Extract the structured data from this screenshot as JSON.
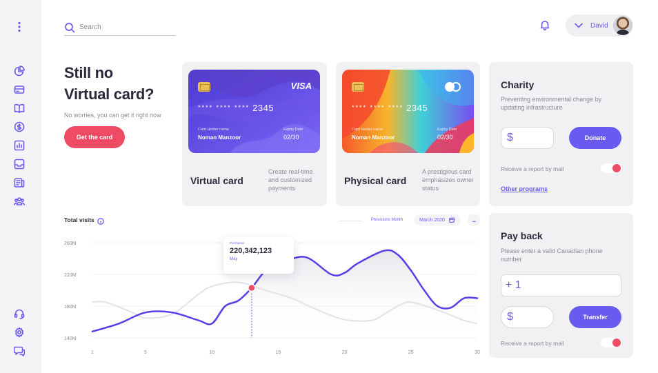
{
  "header": {
    "search_placeholder": "Search",
    "user_name": "David"
  },
  "sidebar": {
    "items": [
      "menu-dots",
      "pie-chart",
      "credit-card",
      "book",
      "dollar",
      "bar-chart",
      "inbox",
      "news",
      "people"
    ],
    "bottom_items": [
      "headset",
      "settings",
      "chat"
    ]
  },
  "hero": {
    "title_line1": "Still no",
    "title_line2": "Virtual card?",
    "subtitle": "No worries, you can get it right now",
    "button_label": "Get the card"
  },
  "virtual_card": {
    "brand": "VISA",
    "number_masked": "**** **** ****",
    "number_last": "2345",
    "holder_label": "Card Holder name",
    "holder_name": "Noman Manzoor",
    "expiry_label": "Expiry Date",
    "expiry": "02/30",
    "title": "Virtual card",
    "description": "Create real-time and customized payments"
  },
  "physical_card": {
    "number_masked": "**** **** ****",
    "number_last": "2345",
    "holder_label": "Card Holder name",
    "holder_name": "Noman Manzoor",
    "expiry_label": "Expiry Date",
    "expiry": "02/30",
    "title": "Physical card",
    "description": "A prestigious card emphasizes owner status"
  },
  "charity": {
    "title": "Charity",
    "description": "Preventing environmental change by updating infrastructure",
    "currency_symbol": "$",
    "donate_label": "Donate",
    "report_label": "Receive a report by mail",
    "report_toggle_on": true,
    "link_label": "Other programs"
  },
  "payback": {
    "title": "Pay back",
    "description": "Please enter a valid Canadian phone number",
    "phone_prefix": "+ 1",
    "currency_symbol": "$",
    "transfer_label": "Transfer",
    "report_label": "Receive a report by mail",
    "report_toggle_on": true
  },
  "chart_controls": {
    "title": "Total visits",
    "legend_label": "Provisions Month",
    "month_label": "March 2020",
    "more_label": "..."
  },
  "tooltip": {
    "label": "Purchases",
    "value": "220,342,123",
    "month": "May"
  },
  "colors": {
    "accent": "#6a5bf0",
    "primary_button": "#ef4b64",
    "panel_bg": "#f1f1f3"
  },
  "chart_data": {
    "type": "line",
    "title": "Total visits",
    "x_ticks": [
      "1",
      "5",
      "10",
      "15",
      "20",
      "25",
      "30"
    ],
    "y_ticks": [
      "260M",
      "220M",
      "180M",
      "140M"
    ],
    "xlim": [
      1,
      30
    ],
    "ylim": [
      140,
      260
    ],
    "highlight": {
      "x": 13,
      "y": 203
    },
    "series": [
      {
        "name": "Provisions Month",
        "role": "main",
        "color": "#5a3de6",
        "x": [
          1,
          3,
          5,
          7,
          9,
          10,
          11,
          12,
          13,
          14,
          15,
          17,
          19,
          20,
          21,
          23,
          24,
          25,
          26,
          27,
          28,
          29,
          30
        ],
        "y": [
          148,
          158,
          172,
          172,
          162,
          158,
          180,
          187,
          203,
          224,
          232,
          242,
          220,
          222,
          234,
          250,
          245,
          225,
          200,
          180,
          178,
          190,
          190
        ]
      },
      {
        "name": "",
        "role": "background",
        "color": "#e2e2e8",
        "x": [
          1,
          2,
          4,
          5,
          7,
          9,
          10,
          12,
          14,
          16,
          18,
          20,
          22,
          23,
          24,
          25,
          27,
          29,
          30
        ],
        "y": [
          185,
          185,
          172,
          165,
          170,
          195,
          205,
          210,
          200,
          190,
          175,
          163,
          162,
          170,
          180,
          185,
          175,
          162,
          158
        ]
      }
    ]
  }
}
